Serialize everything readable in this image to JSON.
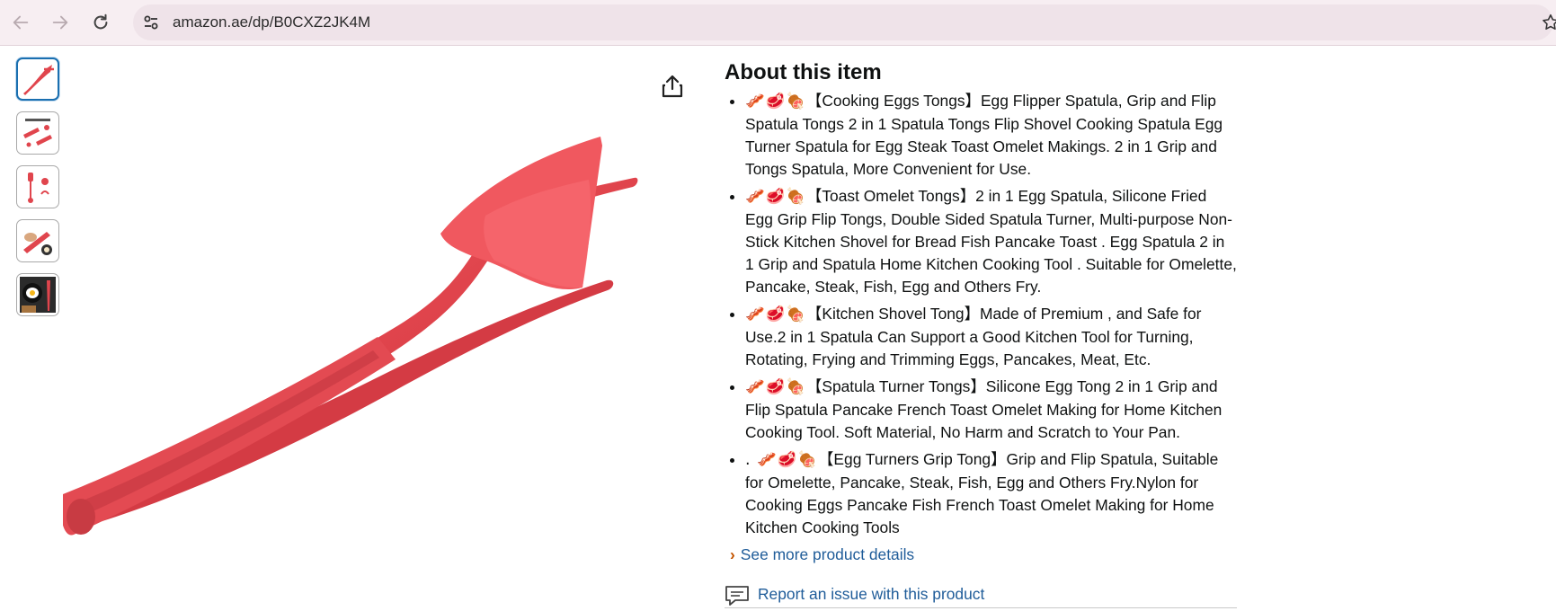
{
  "browser": {
    "url": "amazon.ae/dp/B0CXZ2JK4M",
    "back_icon": "back-arrow-icon",
    "forward_icon": "forward-arrow-icon",
    "reload_icon": "reload-icon",
    "site_info_icon": "tune-icon",
    "bookmark_icon": "star-icon"
  },
  "gallery": {
    "thumbnails": [
      {
        "icon": "spatula-thumbnail",
        "selected": true
      },
      {
        "icon": "product-infographic-thumbnail"
      },
      {
        "icon": "spatula-parts-thumbnail"
      },
      {
        "icon": "spatula-in-hand-thumbnail"
      },
      {
        "icon": "egg-pan-thumbnail"
      }
    ],
    "main_image_icon": "red-spatula-tong-image",
    "share_icon": "share-icon"
  },
  "about": {
    "heading": "About this item",
    "bullets": [
      {
        "emoji": "🥓🥩🍖",
        "text": "【Cooking Eggs Tongs】Egg Flipper Spatula, Grip and Flip Spatula Tongs 2 in 1 Spatula Tongs Flip Shovel Cooking Spatula Egg Turner Spatula for Egg Steak Toast Omelet Makings. 2 in 1 Grip and Tongs Spatula, More Convenient for Use."
      },
      {
        "emoji": "🥓🥩🍖",
        "text": "【Toast Omelet Tongs】2 in 1 Egg Spatula, Silicone Fried Egg Grip Flip Tongs, Double Sided Spatula Turner, Multi-purpose Non-Stick Kitchen Shovel for Bread Fish Pancake Toast . Egg Spatula 2 in 1 Grip and Spatula Home Kitchen Cooking Tool . Suitable for Omelette, Pancake, Steak, Fish, Egg and Others Fry."
      },
      {
        "emoji": "🥓🥩🍖",
        "text": "【Kitchen Shovel Tong】Made of Premium , and Safe for Use.2 in 1 Spatula Can Support a Good Kitchen Tool for Turning, Rotating, Frying and Trimming Eggs, Pancakes, Meat, Etc."
      },
      {
        "emoji": "🥓🥩🍖",
        "text": "【Spatula Turner Tongs】Silicone Egg Tong 2 in 1 Grip and Flip Spatula Pancake French Toast Omelet Making for Home Kitchen Cooking Tool. Soft Material, No Harm and Scratch to Your Pan."
      },
      {
        "emoji": ". 🥓🥩🍖",
        "text": "【Egg Turners Grip Tong】Grip and Flip Spatula, Suitable for Omelette, Pancake, Steak, Fish, Egg and Others Fry.Nylon for Cooking Eggs Pancake Fish French Toast Omelet Making for Home Kitchen Cooking Tools"
      }
    ],
    "see_more": "See more product details",
    "see_more_icon": "chevron-right-icon",
    "report": "Report an issue with this product",
    "report_icon": "report-comment-icon"
  },
  "colors": {
    "toolbar_bg": "#f7eef2",
    "link": "#1f5c99",
    "chevron": "#c45500",
    "product_red": "#e0454d",
    "selected_thumb_border": "#1a6fb0"
  }
}
